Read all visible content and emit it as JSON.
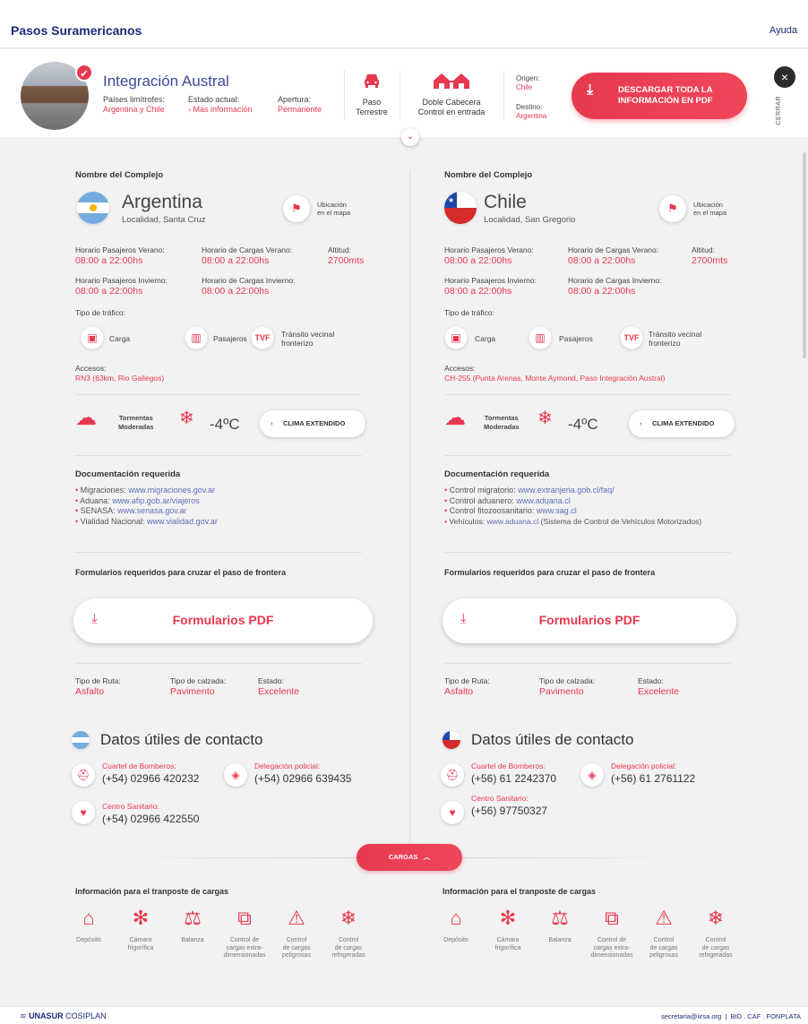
{
  "topbar": {
    "brand": "Pasos Suramericanos",
    "help": "Ayuda"
  },
  "header": {
    "pass_name": "Integración Austral",
    "paises_label": "Países limítrofes:",
    "paises_value": "Argentina y Chile",
    "estado_label": "Estado actual:",
    "estado_value": "Más información",
    "apertura_label": "Apertura:",
    "apertura_value": "Permanente",
    "paso_line1": "Paso",
    "paso_line2": "Terrestre",
    "doble_line1": "Doble Cabecera",
    "doble_line2": "Control en entrada",
    "origen_label": "Origen:",
    "origen_value": "Chile",
    "destino_label": "Destino:",
    "destino_value": "Argentina",
    "download_all": "DESCARGAR TODA LA INFORMACIÓN EN PDF",
    "close_label": "CERRAR"
  },
  "argentina": {
    "complex_title": "Nombre del Complejo",
    "country": "Argentina",
    "locality": "Localidad, Santa Cruz",
    "map_label_1": "Ubicación",
    "map_label_2": "en el mapa",
    "hp_verano_label": "Horario Pasajeros Verano:",
    "hp_verano": "08:00 a 22:00hs",
    "hc_verano_label": "Horario de Cargas Verano:",
    "hc_verano": "08:00 a 22:00hs",
    "altitud_label": "Altitud:",
    "altitud": "2700mts",
    "hp_invierno_label": "Horario Pasajeros Invierno:",
    "hp_invierno": "08:00 a 22:00hs",
    "hc_invierno_label": "Horario de Cargas Invierno:",
    "hc_invierno": "08:00 a 22:00hs",
    "traffic_title": "Tipo de tráfico:",
    "traffic_carga": "Carga",
    "traffic_pasajeros": "Pasajeros",
    "traffic_tvf_1": "Tránsito vecinal",
    "traffic_tvf_2": "fronterizo",
    "accesos_label": "Accesos:",
    "accesos": "RN3  (63km, Rio Gallegos)",
    "weather_1": "Tormentas",
    "weather_2": "Moderadas",
    "temp": "-4ºC",
    "clima_btn": "CLIMA EXTENDIDO",
    "docs_title": "Documentación requerida",
    "docs": [
      {
        "label": "Migraciones: ",
        "link": "www.migraciones.gov.ar",
        "extra": ""
      },
      {
        "label": "Aduana: ",
        "link": "www.afip.gob.ar/viajeros",
        "extra": ""
      },
      {
        "label": "SENASA: ",
        "link": "www.senasa.gov.ar",
        "extra": ""
      },
      {
        "label": "Vialidad Nacional: ",
        "link": "www.vialidad.gov.ar",
        "extra": ""
      }
    ],
    "forms_title": "Formularios requeridos para cruzar el paso de frontera",
    "forms_btn": "Formularios PDF",
    "ruta_label": "Tipo de Ruta:",
    "ruta": "Asfalto",
    "calzada_label": "Tipo de calzada:",
    "calzada": "Pavimento",
    "estado_label": "Estado:",
    "estado": "Excelente",
    "contact_title": "Datos útiles de contacto",
    "bomberos_label": "Cuartel de Bomberos:",
    "bomberos": "(+54) 02966 420232",
    "policia_label": "Delegación policial:",
    "policia": "(+54) 02966 639435",
    "sanitario_label": "Centro Sanitario:",
    "sanitario": "(+54) 02966 422550"
  },
  "chile": {
    "complex_title": "Nombre del Complejo",
    "country": "Chile",
    "locality": "Localidad, San Gregorio",
    "map_label_1": "Ubicación",
    "map_label_2": "en el mapa",
    "hp_verano_label": "Horario Pasajeros Verano:",
    "hp_verano": "08:00 a 22:00hs",
    "hc_verano_label": "Horario de Cargas Verano:",
    "hc_verano": "08:00 a 22:00hs",
    "altitud_label": "Altitud:",
    "altitud": "2700mts",
    "hp_invierno_label": "Horario Pasajeros Invierno:",
    "hp_invierno": "08:00 a 22:00hs",
    "hc_invierno_label": "Horario de Cargas Invierno:",
    "hc_invierno": "08:00 a 22:00hs",
    "traffic_title": "Tipo de tráfico:",
    "traffic_carga": "Carga",
    "traffic_pasajeros": "Pasajeros",
    "traffic_tvf_1": "Tránsito vecinal",
    "traffic_tvf_2": "fronterizo",
    "accesos_label": "Accesos:",
    "accesos": "CH-255 (Punta Arenas, Monte Aymond, Paso Integración Austral)",
    "weather_1": "Tormentas",
    "weather_2": "Moderadas",
    "temp": "-4ºC",
    "clima_btn": "CLIMA EXTENDIDO",
    "docs_title": "Documentación requerida",
    "docs": [
      {
        "label": "Control migratorio: ",
        "link": "www.extranjeria.gob.cl/faq/",
        "extra": ""
      },
      {
        "label": "Control aduanero: ",
        "link": "www.aduana.cl",
        "extra": ""
      },
      {
        "label": "Control fitozoosanitario: ",
        "link": "www.sag.cl",
        "extra": ""
      },
      {
        "label": "Vehículos: ",
        "link": "www.aduana.cl",
        "extra": " (Sistema de Control de Vehículos Motorizados)"
      }
    ],
    "forms_title": "Formularios requeridos para cruzar el paso de frontera",
    "forms_btn": "Formularios PDF",
    "ruta_label": "Tipo de Ruta:",
    "ruta": "Asfalto",
    "calzada_label": "Tipo de calzada:",
    "calzada": "Pavimento",
    "estado_label": "Estado:",
    "estado": "Excelente",
    "contact_title": "Datos útiles de contacto",
    "bomberos_label": "Cuartel de Bomberos:",
    "bomberos": "(+56) 61 2242370",
    "policia_label": "Delegación policial:",
    "policia": "(+56) 61 2761122",
    "sanitario_label": "Centro Sanitario:",
    "sanitario": "(+56) 97750327"
  },
  "cargas": {
    "button": "CARGAS",
    "title": "Información para el tranposte de cargas",
    "items": [
      {
        "l1": "Depósito",
        "l2": "",
        "l3": "",
        "icon": "warehouse-icon"
      },
      {
        "l1": "Cámara",
        "l2": "frigorífica",
        "l3": "",
        "icon": "snowflake-icon"
      },
      {
        "l1": "Balanza",
        "l2": "",
        "l3": "",
        "icon": "scale-icon"
      },
      {
        "l1": "Control de",
        "l2": "cargas extra-",
        "l3": "dimensionadas",
        "icon": "oversize-cargo-icon"
      },
      {
        "l1": "Control",
        "l2": "de cargas",
        "l3": "peligrosas",
        "icon": "hazard-cargo-icon"
      },
      {
        "l1": "Control",
        "l2": "de cargas",
        "l3": "refrigeradas",
        "icon": "refrigerated-cargo-icon"
      }
    ]
  },
  "footer": {
    "org": "UNASUR",
    "org2": "COSIPLAN",
    "contact": "secretaria@iirsa.org",
    "partners": "BID . CAF . FONPLATA"
  },
  "colors": {
    "accent": "#e8384f",
    "brand": "#1e2a78",
    "link": "#5d6fb8"
  }
}
